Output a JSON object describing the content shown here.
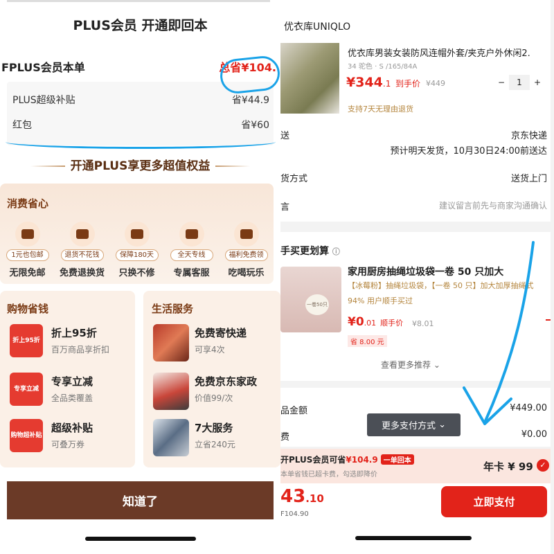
{
  "left": {
    "header_title": "PLUS会员 开通即回本",
    "order": {
      "title": "FPLUS会员本单",
      "total": "总省¥104.",
      "rows": [
        {
          "label": "PLUS超级补贴",
          "value": "省¥44.9"
        },
        {
          "label": "红包",
          "value": "省¥60"
        }
      ]
    },
    "benefit_title": "开通PLUS享更多超值权益",
    "consume": {
      "title": "消费省心",
      "icons": [
        {
          "icon": "truck-icon",
          "pill": "1元也包邮",
          "label": "无限免邮"
        },
        {
          "icon": "return-bag-icon",
          "pill": "退货不花钱",
          "label": "免费退换货"
        },
        {
          "icon": "shield-icon",
          "pill": "保障180天",
          "label": "只换不修"
        },
        {
          "icon": "headset-icon",
          "pill": "全天专线",
          "label": "专属客服"
        },
        {
          "icon": "cup-icon",
          "pill": "福利免费领",
          "label": "吃喝玩乐"
        }
      ]
    },
    "shopping": {
      "title": "购物省钱",
      "items": [
        {
          "badge": "折上95折",
          "name": "折上95折",
          "sub": "百万商品享折扣"
        },
        {
          "badge": "专享立减",
          "name": "专享立减",
          "sub": "全品类覆盖"
        },
        {
          "badge": "购物超补贴",
          "name": "超级补贴",
          "sub": "可叠万券"
        }
      ]
    },
    "life": {
      "title": "生活服务",
      "items": [
        {
          "name": "免费寄快递",
          "sub": "可享4次"
        },
        {
          "name": "免费京东家政",
          "sub": "价值99/次"
        },
        {
          "name": "7大服务",
          "sub": "立省240元"
        }
      ]
    },
    "confirm_button": "知道了"
  },
  "right": {
    "shop_name": "优衣库UNIQLO",
    "product": {
      "title": "优衣库男装女装防风连帽外套/夹克户外休闲2.",
      "spec": "34 驼色 · S /165/84A",
      "price_int": "¥344",
      "price_dec": ".1",
      "price_tag": "到手价",
      "old_price": "¥449",
      "qty": "1",
      "qty_minus": "−",
      "qty_plus": "+",
      "returns": "支持7天无理由退货"
    },
    "delivery": {
      "label": "送",
      "value": "京东快递",
      "note": "预计明天发货，10月30日24:00前送达"
    },
    "goods_method": {
      "label": "货方式",
      "value": "送货上门"
    },
    "message": {
      "label": "言",
      "value": "建议留言前先与商家沟通确认"
    },
    "buy_title": "手买更划算",
    "addon": {
      "title": "家用厨房抽绳垃圾袋一卷 50 只加大",
      "sub": "【冰莓粉】抽绳垃圾袋，【一卷 50 只】加大加厚抽绳式",
      "pct": "94% 用户顺手买过",
      "price_int": "¥0",
      "price_dec": ".01",
      "price_tag": "顺手价",
      "old_price": "¥8.01",
      "save": "省 8.00 元",
      "pack_text": "一卷50只"
    },
    "see_more": "查看更多推荐",
    "goods_amount": {
      "label": "品金额",
      "value": "¥449.00"
    },
    "fee": {
      "label": "费",
      "value": "¥0.00"
    },
    "more_pay": "更多支付方式",
    "plus": {
      "line1_prefix": "开PLUS会员可省",
      "line1_amount": "¥104.9",
      "tag": "一单回本",
      "line2": "本单省钱已超卡费，勾选即降价",
      "annual": "年卡 ¥ 99"
    },
    "total": {
      "int": "43",
      "dec": ".10",
      "orig": "F104.90"
    },
    "pay_now": "立即支付"
  }
}
